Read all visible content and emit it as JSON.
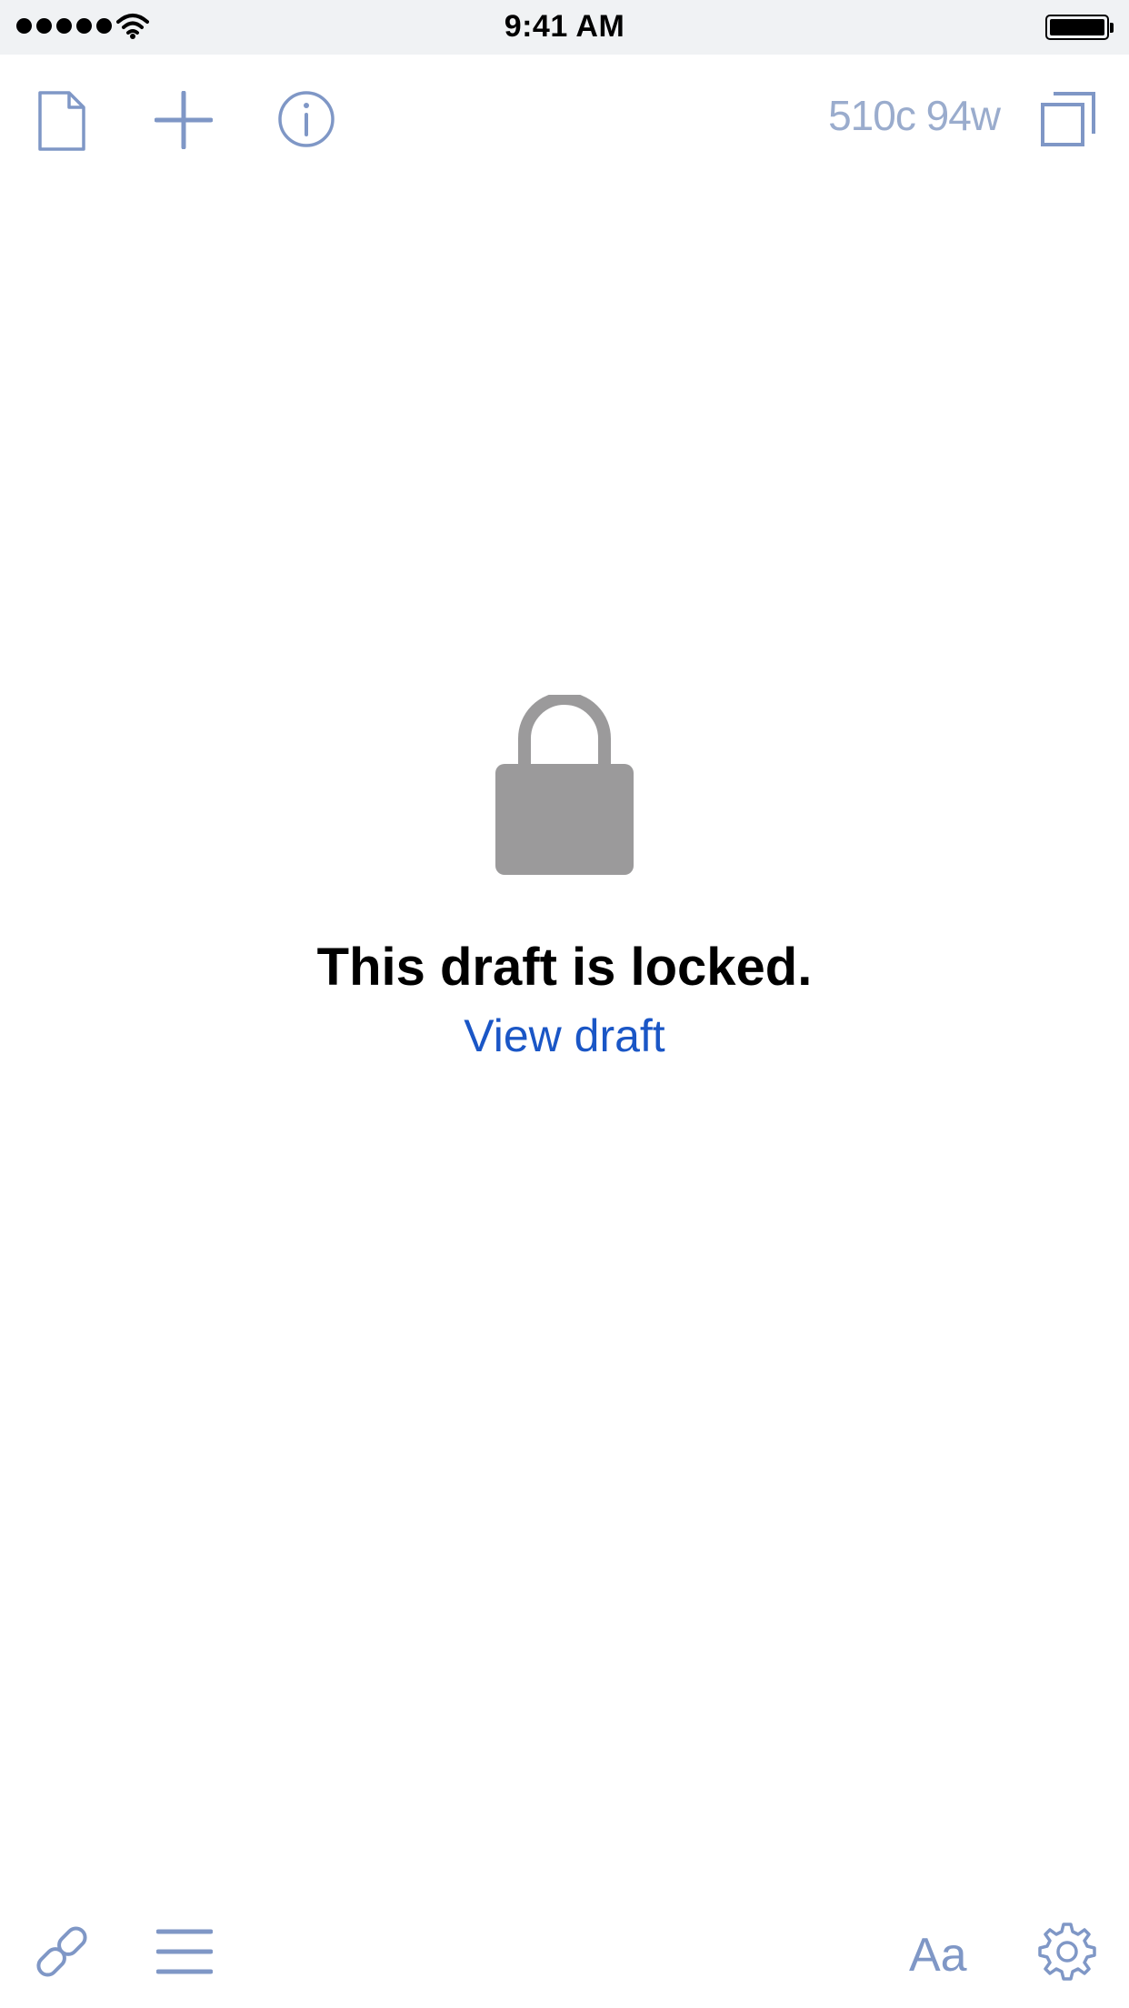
{
  "status_bar": {
    "time": "9:41 AM",
    "signal_bars": 5,
    "battery_level": 1.0
  },
  "toolbar": {
    "counter": "510c 94w",
    "icons": [
      "document-icon",
      "plus-icon",
      "info-icon",
      "expand-icon"
    ]
  },
  "locked": {
    "title": "This draft is locked.",
    "link": "View draft"
  },
  "bottom_toolbar": {
    "font_label": "Aa",
    "icons": [
      "link-icon",
      "menu-icon",
      "gear-icon"
    ]
  },
  "colors": {
    "toolbar_icon": "#7f97c6",
    "link": "#1a56c6",
    "lock": "#9b9a9b",
    "status_bar_bg": "#f0f2f4"
  }
}
